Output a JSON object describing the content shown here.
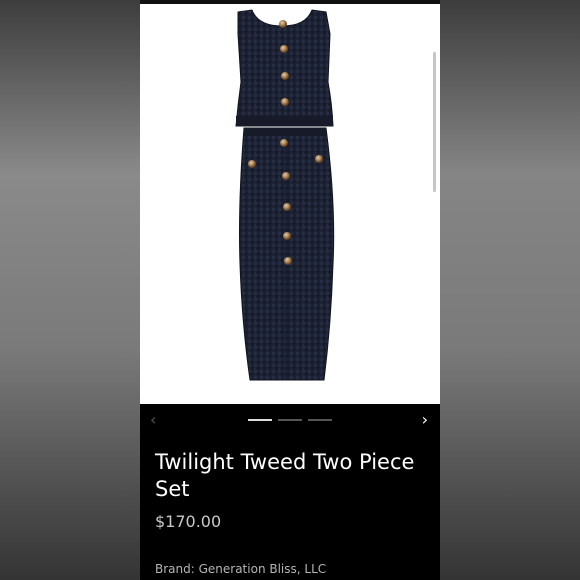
{
  "listing": {
    "title": "Twilight Tweed Two Piece Set",
    "price": "$170.00",
    "brand": "Brand: Generation Bliss, LLC"
  },
  "carousel": {
    "prev_icon": "chevron-left-icon",
    "next_icon": "chevron-right-icon",
    "slide_count": 3,
    "active_slide": 1
  },
  "colors": {
    "background": "#000000",
    "garment": "#1d2233",
    "button_gold": "#b08a5a",
    "text_primary": "#ffffff",
    "text_secondary": "#c9c9c9"
  }
}
